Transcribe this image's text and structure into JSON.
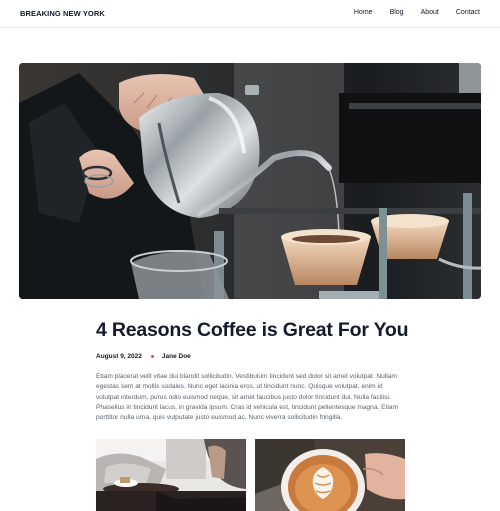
{
  "header": {
    "brand": "BREAKING NEW YORK",
    "nav": [
      "Home",
      "Blog",
      "About",
      "Contact"
    ]
  },
  "hero": {
    "icon": "coffee-pour-photo"
  },
  "article": {
    "title": "4 Reasons Coffee is Great For You",
    "date": "August 9, 2022",
    "author": "Jane Doe",
    "body": "Etiam placerat velit vitae dui blandit sollicitudin. Vestibulum tincidunt sed dolor sit amet volutpat. Nullam egestas sem at mollis sodales. Nunc eget lacinia eros, ut tincidunt nunc. Quisque volutpat, enim id volutpat interdum, purus odio euismod neque, sit amet faucibus justo dolor tincidunt dui. Nulla facilisi. Phasellus in tincidunt lacus, in gravida ipsum. Cras id vehicula est, tincidunt pellentesque magna. Etiam porttitor nulla urna, quis vulputate justo euismod ac. Nunc viverra sollicitudin fringilla."
  },
  "colors": {
    "accent_dot": "#e0533d",
    "title": "#141b2d",
    "body": "#5b6170"
  }
}
